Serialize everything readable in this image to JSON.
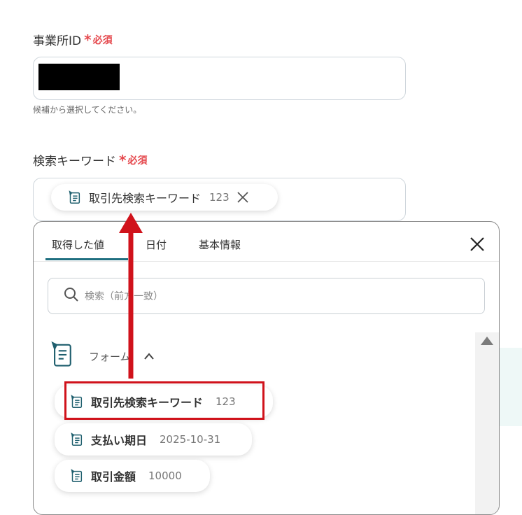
{
  "fields": {
    "office_id": {
      "label": "事業所ID",
      "required_mark": "*",
      "required_label": "必須",
      "help_text": "候補から選択してください。"
    },
    "search_keyword": {
      "label": "検索キーワード",
      "required_mark": "*",
      "required_label": "必須",
      "chip": {
        "label": "取引先検索キーワード",
        "value": "123"
      }
    }
  },
  "picker": {
    "tabs": [
      {
        "label": "取得した値",
        "active": true
      },
      {
        "label": "日付",
        "active": false
      },
      {
        "label": "基本情報",
        "active": false
      }
    ],
    "search_placeholder": "検索（前方一致）",
    "section_label": "フォーム",
    "items": [
      {
        "label": "取引先検索キーワード",
        "value": "123",
        "highlighted": true
      },
      {
        "label": "支払い期日",
        "value": "2025-10-31",
        "highlighted": false
      },
      {
        "label": "取引金額",
        "value": "10000",
        "highlighted": false
      }
    ]
  },
  "colors": {
    "required": "#e5484d",
    "tab_active": "#1f6f80",
    "highlight_box": "#d0121b",
    "arrow": "#d0121b"
  }
}
